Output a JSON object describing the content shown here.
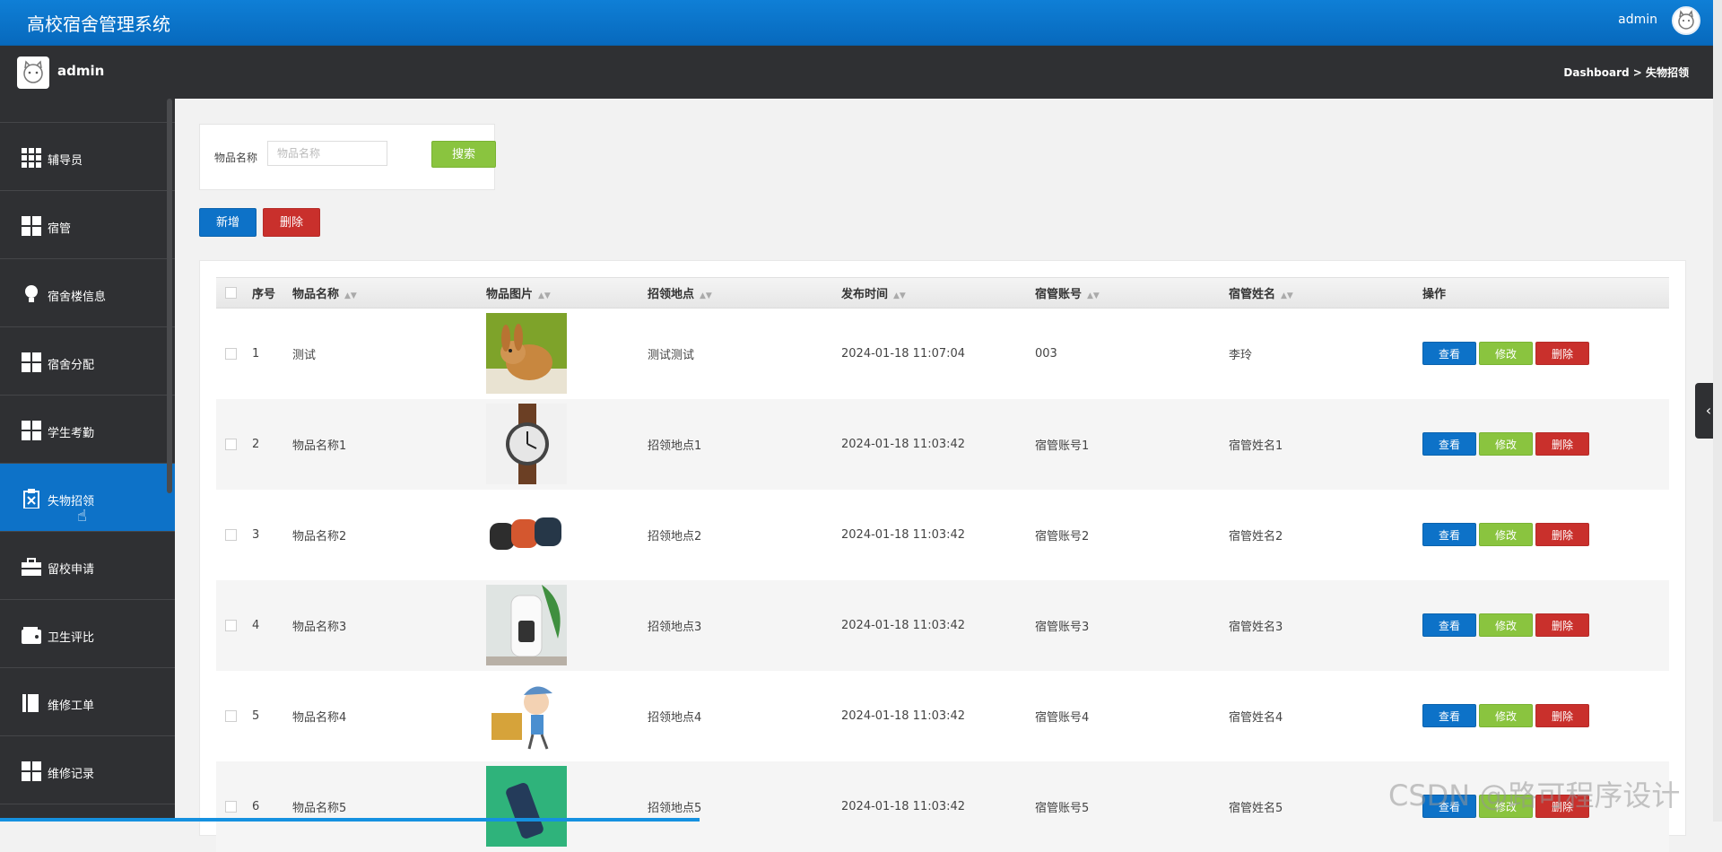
{
  "header": {
    "title": "高校宿舍管理系统",
    "user": "admin"
  },
  "subheader": {
    "username": "admin",
    "breadcrumb": "Dashboard > 失物招领"
  },
  "sidebar": {
    "items": [
      {
        "label": "辅导员",
        "icon": "grid-icon"
      },
      {
        "label": "宿管",
        "icon": "grid-icon"
      },
      {
        "label": "宿舍楼信息",
        "icon": "lightbulb-icon"
      },
      {
        "label": "宿舍分配",
        "icon": "grid-icon"
      },
      {
        "label": "学生考勤",
        "icon": "grid-icon"
      },
      {
        "label": "失物招领",
        "icon": "clipboard-icon",
        "active": true
      },
      {
        "label": "留校申请",
        "icon": "briefcase-icon"
      },
      {
        "label": "卫生评比",
        "icon": "wallet-icon"
      },
      {
        "label": "维修工单",
        "icon": "book-icon"
      },
      {
        "label": "维修记录",
        "icon": "grid-icon"
      }
    ]
  },
  "search": {
    "label": "物品名称",
    "placeholder": "物品名称",
    "button": "搜索"
  },
  "actions": {
    "add": "新增",
    "delete": "删除"
  },
  "table": {
    "columns": [
      "序号",
      "物品名称",
      "物品图片",
      "招领地点",
      "发布时间",
      "宿管账号",
      "宿管姓名",
      "操作"
    ],
    "row_buttons": {
      "view": "查看",
      "edit": "修改",
      "delete": "删除"
    },
    "rows": [
      {
        "no": "1",
        "name": "测试",
        "image": "rabbit",
        "place": "测试测试",
        "time": "2024-01-18 11:07:04",
        "account": "003",
        "manager": "李玲"
      },
      {
        "no": "2",
        "name": "物品名称1",
        "image": "watch",
        "place": "招领地点1",
        "time": "2024-01-18 11:03:42",
        "account": "宿管账号1",
        "manager": "宿管姓名1"
      },
      {
        "no": "3",
        "name": "物品名称2",
        "image": "trackers",
        "place": "招领地点2",
        "time": "2024-01-18 11:03:42",
        "account": "宿管账号2",
        "manager": "宿管姓名2"
      },
      {
        "no": "4",
        "name": "物品名称3",
        "image": "humidifier",
        "place": "招领地点3",
        "time": "2024-01-18 11:03:42",
        "account": "宿管账号3",
        "manager": "宿管姓名3"
      },
      {
        "no": "5",
        "name": "物品名称4",
        "image": "cartoon-boy",
        "place": "招领地点4",
        "time": "2024-01-18 11:03:42",
        "account": "宿管账号4",
        "manager": "宿管姓名4"
      },
      {
        "no": "6",
        "name": "物品名称5",
        "image": "green-device",
        "place": "招领地点5",
        "time": "2024-01-18 11:03:42",
        "account": "宿管账号5",
        "manager": "宿管姓名5"
      }
    ]
  },
  "watermark": "CSDN @路可程序设计",
  "colors": {
    "primary": "#0d72c8",
    "success": "#8ac43f",
    "danger": "#c9302c",
    "sidebar": "#2f3033"
  }
}
